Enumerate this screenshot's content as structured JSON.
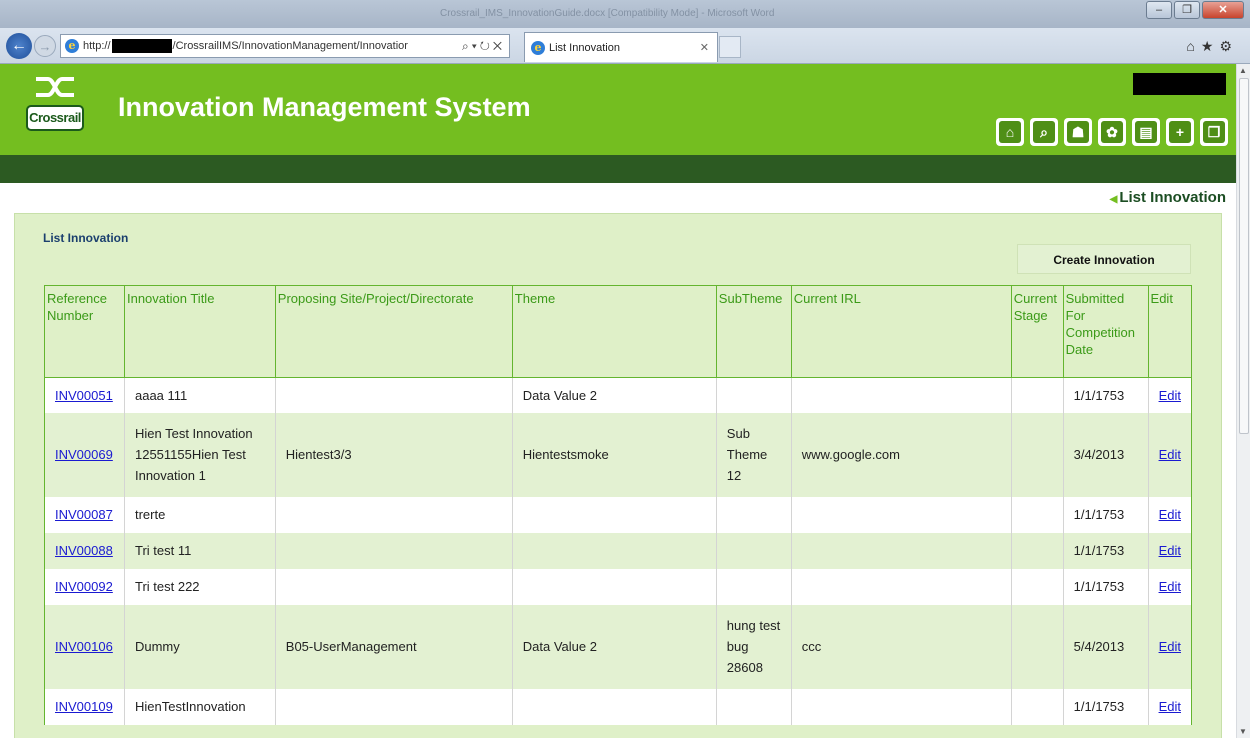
{
  "browser": {
    "url_prefix": "http://",
    "url_suffix": "/CrossrailIMS/InnovationManagement/Innovatior",
    "tab_title": "List Innovation",
    "window_title": "Crossrail_IMS_InnovationGuide.docx [Compatibility Mode] - Microsoft Word"
  },
  "header": {
    "logo_text": "Crossrail",
    "app_title": "Innovation Management System",
    "tool_icons": [
      "home-icon",
      "search-icon",
      "user-icon",
      "settings-icon",
      "report-icon",
      "add-icon",
      "pages-icon"
    ]
  },
  "breadcrumb": {
    "current": "List Innovation"
  },
  "panel": {
    "title": "List Innovation",
    "create_button": "Create Innovation"
  },
  "table": {
    "columns": [
      "Reference Number",
      "Innovation Title",
      "Proposing Site/Project/Directorate",
      "Theme",
      "SubTheme",
      "Current IRL",
      "Current Stage",
      "Submitted For Competition Date",
      "Edit"
    ],
    "rows": [
      {
        "ref": "INV00051",
        "title": "aaaa 111",
        "site": "",
        "theme": "Data Value 2",
        "subtheme": "",
        "irl": "",
        "stage": "",
        "date": "1/1/1753",
        "edit": "Edit"
      },
      {
        "ref": "INV00069",
        "title": "Hien Test Innovation 12551155Hien Test Innovation 1",
        "site": "Hientest3/3",
        "theme": "Hientestsmoke",
        "subtheme": "Sub Theme 12",
        "irl": "www.google.com",
        "stage": "",
        "date": "3/4/2013",
        "edit": "Edit"
      },
      {
        "ref": "INV00087",
        "title": "trerte",
        "site": "",
        "theme": "",
        "subtheme": "",
        "irl": "",
        "stage": "",
        "date": "1/1/1753",
        "edit": "Edit"
      },
      {
        "ref": "INV00088",
        "title": "Tri test 11",
        "site": "",
        "theme": "",
        "subtheme": "",
        "irl": "",
        "stage": "",
        "date": "1/1/1753",
        "edit": "Edit"
      },
      {
        "ref": "INV00092",
        "title": "Tri test 222",
        "site": "",
        "theme": "",
        "subtheme": "",
        "irl": "",
        "stage": "",
        "date": "1/1/1753",
        "edit": "Edit"
      },
      {
        "ref": "INV00106",
        "title": "Dummy",
        "site": "B05-UserManagement",
        "theme": "Data Value 2",
        "subtheme": "hung test bug 28608",
        "irl": "ccc",
        "stage": "",
        "date": "5/4/2013",
        "edit": "Edit"
      },
      {
        "ref": "INV00109",
        "title": "HienTestInnovation",
        "site": "",
        "theme": "",
        "subtheme": "",
        "irl": "",
        "stage": "",
        "date": "1/1/1753",
        "edit": "Edit"
      }
    ]
  }
}
